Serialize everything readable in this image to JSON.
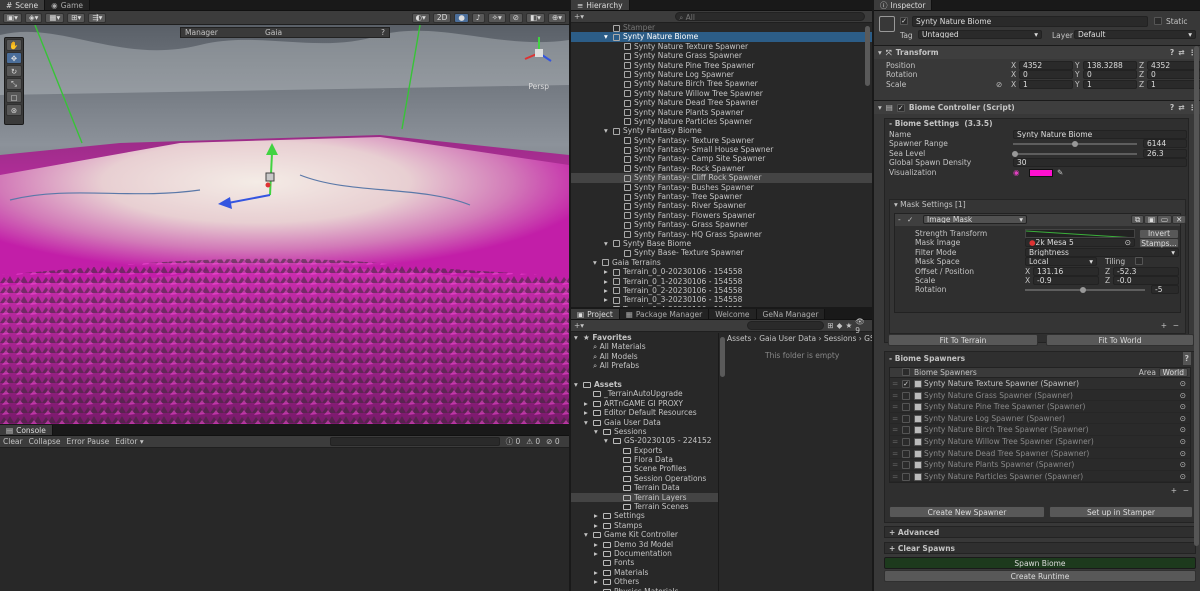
{
  "scene": {
    "tabs": [
      "Scene",
      "Game"
    ],
    "mode_2d": "2D",
    "gaia_label": "Gaia",
    "manager_label": "Manager",
    "persp_label": "Persp"
  },
  "console": {
    "tab": "Console",
    "clear": "Clear",
    "collapse": "Collapse",
    "error_pause": "Error Pause",
    "editor": "Editor",
    "count_info": "0",
    "count_warn": "0",
    "count_error": "0"
  },
  "hierarchy": {
    "tab": "Hierarchy",
    "search_placeholder": "All",
    "items": [
      {
        "label": "Stamper",
        "indent": 3,
        "state": "dim"
      },
      {
        "label": "Synty Nature Biome",
        "indent": 3,
        "state": "selected",
        "fold": "▾"
      },
      {
        "label": "Synty Nature Texture Spawner",
        "indent": 4
      },
      {
        "label": "Synty Nature Grass Spawner",
        "indent": 4
      },
      {
        "label": "Synty Nature Pine Tree Spawner",
        "indent": 4
      },
      {
        "label": "Synty Nature Log Spawner",
        "indent": 4
      },
      {
        "label": "Synty Nature Birch Tree Spawner",
        "indent": 4
      },
      {
        "label": "Synty Nature Willow Tree Spawner",
        "indent": 4
      },
      {
        "label": "Synty Nature Dead Tree Spawner",
        "indent": 4
      },
      {
        "label": "Synty Nature Plants Spawner",
        "indent": 4
      },
      {
        "label": "Synty Nature Particles Spawner",
        "indent": 4
      },
      {
        "label": "Synty Fantasy Biome",
        "indent": 3,
        "fold": "▾"
      },
      {
        "label": "Synty Fantasy- Texture Spawner",
        "indent": 4
      },
      {
        "label": "Synty Fantasy- Small House Spawner",
        "indent": 4
      },
      {
        "label": "Synty Fantasy- Camp Site Spawner",
        "indent": 4
      },
      {
        "label": "Synty Fantasy- Rock Spawner",
        "indent": 4
      },
      {
        "label": "Synty Fantasy- Cliff Rock Spawner",
        "indent": 4,
        "state": "hover"
      },
      {
        "label": "Synty Fantasy- Bushes Spawner",
        "indent": 4
      },
      {
        "label": "Synty Fantasy- Tree Spawner",
        "indent": 4
      },
      {
        "label": "Synty Fantasy- River Spawner",
        "indent": 4
      },
      {
        "label": "Synty Fantasy- Flowers Spawner",
        "indent": 4
      },
      {
        "label": "Synty Fantasy- Grass Spawner",
        "indent": 4
      },
      {
        "label": "Synty Fantasy- HQ Grass Spawner",
        "indent": 4
      },
      {
        "label": "Synty Base Biome",
        "indent": 3,
        "fold": "▾"
      },
      {
        "label": "Synty Base- Texture Spawner",
        "indent": 4
      },
      {
        "label": "Gaia Terrains",
        "indent": 2,
        "fold": "▾"
      },
      {
        "label": "Terrain_0_0-20230106 - 154558",
        "indent": 3,
        "fold": "▸"
      },
      {
        "label": "Terrain_0_1-20230106 - 154558",
        "indent": 3,
        "fold": "▸"
      },
      {
        "label": "Terrain_0_2-20230106 - 154558",
        "indent": 3,
        "fold": "▸"
      },
      {
        "label": "Terrain_0_3-20230106 - 154558",
        "indent": 3,
        "fold": "▸"
      },
      {
        "label": "Terrain_0_4-20230106 - 154558",
        "indent": 3,
        "fold": "▸"
      }
    ]
  },
  "project": {
    "tabs": [
      "Project",
      "Package Manager",
      "Welcome",
      "GeNa Manager"
    ],
    "breadcrumb": [
      "Assets",
      "Gaia User Data",
      "Sessions",
      "GS"
    ],
    "empty_message": "This folder is empty",
    "hidden_count": "9",
    "tree": [
      {
        "label": "Favorites",
        "indent": 0,
        "fold": "▾",
        "bold": true,
        "icon": "star"
      },
      {
        "label": "All Materials",
        "indent": 1,
        "icon": "search"
      },
      {
        "label": "All Models",
        "indent": 1,
        "icon": "search"
      },
      {
        "label": "All Prefabs",
        "indent": 1,
        "icon": "search"
      },
      {
        "label": "",
        "indent": 0
      },
      {
        "label": "Assets",
        "indent": 0,
        "fold": "▾",
        "bold": true,
        "icon": "folder"
      },
      {
        "label": "_TerrainAutoUpgrade",
        "indent": 1,
        "icon": "folder"
      },
      {
        "label": "ARTnGAME GI PROXY",
        "indent": 1,
        "fold": "▸",
        "icon": "folder"
      },
      {
        "label": "Editor Default Resources",
        "indent": 1,
        "fold": "▸",
        "icon": "folder"
      },
      {
        "label": "Gaia User Data",
        "indent": 1,
        "fold": "▾",
        "icon": "folder"
      },
      {
        "label": "Sessions",
        "indent": 2,
        "fold": "▾",
        "icon": "folder"
      },
      {
        "label": "GS-20230105 - 224152",
        "indent": 3,
        "fold": "▾",
        "icon": "folder"
      },
      {
        "label": "Exports",
        "indent": 4,
        "icon": "folder"
      },
      {
        "label": "Flora Data",
        "indent": 4,
        "icon": "folder"
      },
      {
        "label": "Scene Profiles",
        "indent": 4,
        "icon": "folder"
      },
      {
        "label": "Session Operations",
        "indent": 4,
        "icon": "folder"
      },
      {
        "label": "Terrain Data",
        "indent": 4,
        "icon": "folder"
      },
      {
        "label": "Terrain Layers",
        "indent": 4,
        "icon": "folder",
        "state": "hover"
      },
      {
        "label": "Terrain Scenes",
        "indent": 4,
        "icon": "folder"
      },
      {
        "label": "Settings",
        "indent": 2,
        "fold": "▸",
        "icon": "folder"
      },
      {
        "label": "Stamps",
        "indent": 2,
        "fold": "▸",
        "icon": "folder"
      },
      {
        "label": "Game Kit Controller",
        "indent": 1,
        "fold": "▾",
        "icon": "folder"
      },
      {
        "label": "Demo 3d Model",
        "indent": 2,
        "fold": "▸",
        "icon": "folder"
      },
      {
        "label": "Documentation",
        "indent": 2,
        "fold": "▸",
        "icon": "folder"
      },
      {
        "label": "Fonts",
        "indent": 2,
        "icon": "folder"
      },
      {
        "label": "Materials",
        "indent": 2,
        "fold": "▸",
        "icon": "folder"
      },
      {
        "label": "Others",
        "indent": 2,
        "fold": "▸",
        "icon": "folder"
      },
      {
        "label": "Physics Materials",
        "indent": 2,
        "icon": "folder"
      }
    ]
  },
  "inspector": {
    "tab": "Inspector",
    "object_name": "Synty Nature Biome",
    "static_label": "Static",
    "tag_label": "Tag",
    "tag_value": "Untagged",
    "layer_label": "Layer",
    "layer_value": "Default",
    "transform": {
      "title": "Transform",
      "rows": [
        {
          "label": "Position",
          "x": "4352",
          "y": "138.3288",
          "z": "4352"
        },
        {
          "label": "Rotation",
          "x": "0",
          "y": "0",
          "z": "0"
        },
        {
          "label": "Scale",
          "x": "1",
          "y": "1",
          "z": "1"
        }
      ]
    },
    "biome": {
      "title": "Biome Controller (Script)",
      "settings_title": "Biome Settings",
      "version": "(3.3.5)",
      "name_label": "Name",
      "name_value": "Synty Nature Biome",
      "range_label": "Spawner Range",
      "range_value": "6144",
      "range_fraction": 0.5,
      "sea_label": "Sea Level",
      "sea_value": "26.3",
      "sea_fraction": 0.02,
      "density_label": "Global Spawn Density",
      "density_value": "30",
      "vis_label": "Visualization",
      "vis_color": "#ff10d0"
    },
    "mask": {
      "title": "Mask Settings [1]",
      "type": "Image Mask",
      "strength_label": "Strength Transform",
      "invert": "Invert",
      "image_label": "Mask Image",
      "image_value": "2k Mesa 5",
      "stamps_button": "Stamps...",
      "filter_label": "Filter Mode",
      "filter_value": "Brightness",
      "space_label": "Mask Space",
      "space_value": "Local",
      "tiling_label": "Tiling",
      "offset_label": "Offset / Position",
      "offset_x": "131.16",
      "offset_z": "-52.3",
      "scale_label": "Scale",
      "scale_x": "-0.9",
      "scale_z": "-0.0",
      "rotation_label": "Rotation",
      "rotation_value": "-5",
      "rotation_fraction": 0.48
    },
    "fit_terrain": "Fit To Terrain",
    "fit_world": "Fit To World",
    "spawners": {
      "title": "Biome Spawners",
      "list_header": "Biome Spawners",
      "area_label": "Area",
      "area_value": "World",
      "items": [
        {
          "label": "Synty Nature Texture Spawner (Spawner)",
          "checked": true
        },
        {
          "label": "Synty Nature Grass Spawner (Spawner)",
          "checked": false
        },
        {
          "label": "Synty Nature Pine Tree Spawner (Spawner)",
          "checked": false
        },
        {
          "label": "Synty Nature Log Spawner (Spawner)",
          "checked": false
        },
        {
          "label": "Synty Nature Birch Tree Spawner (Spawner)",
          "checked": false
        },
        {
          "label": "Synty Nature Willow Tree Spawner (Spawner)",
          "checked": false
        },
        {
          "label": "Synty Nature Dead Tree Spawner (Spawner)",
          "checked": false
        },
        {
          "label": "Synty Nature Plants Spawner (Spawner)",
          "checked": false
        },
        {
          "label": "Synty Nature Particles Spawner (Spawner)",
          "checked": false
        }
      ]
    },
    "create_spawner": "Create New Spawner",
    "setup_stamper": "Set up in Stamper",
    "advanced": "+ Advanced",
    "clear_spawns": "+ Clear Spawns",
    "spawn_biome": "Spawn Biome",
    "create_runtime": "Create Runtime"
  }
}
